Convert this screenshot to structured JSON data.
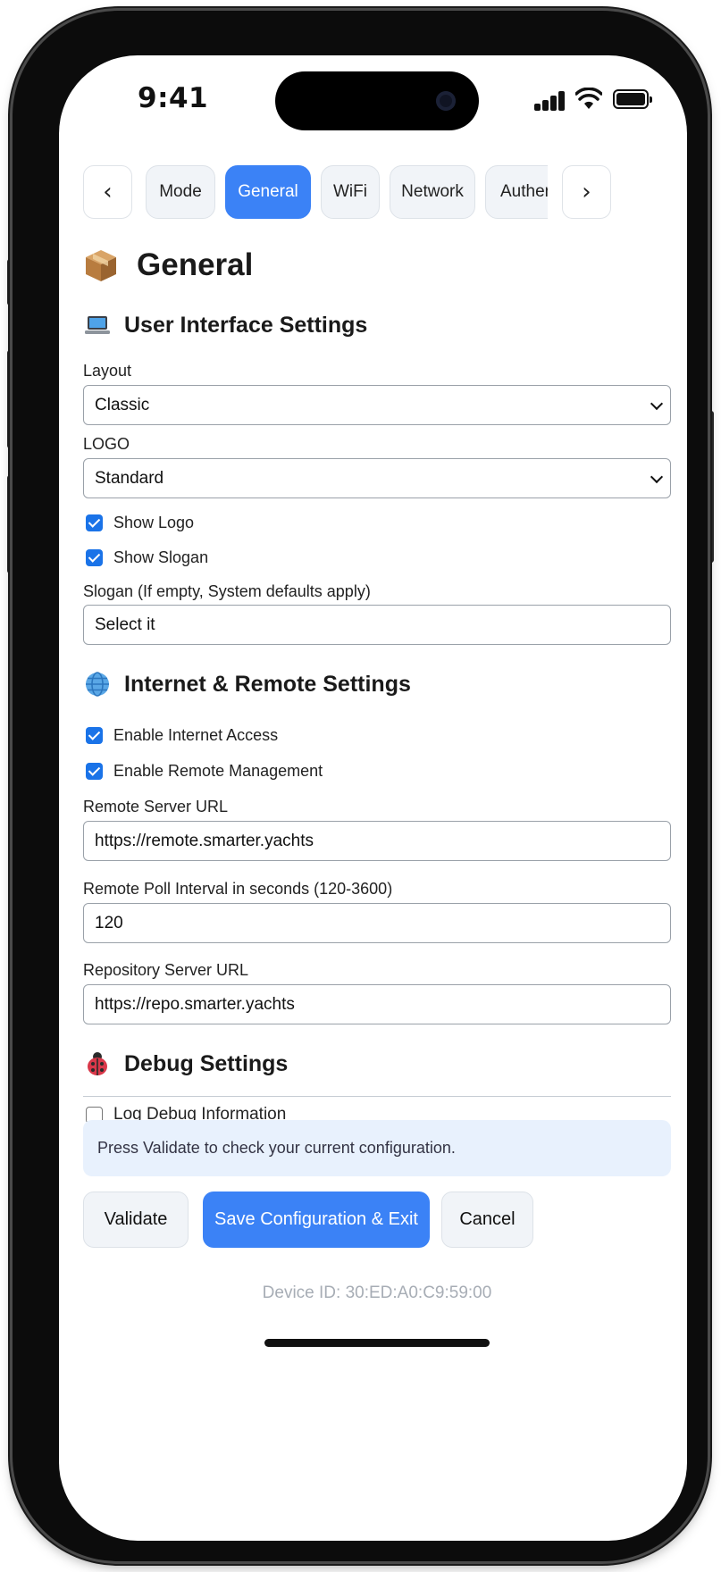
{
  "status": {
    "time": "9:41"
  },
  "tabs": {
    "prev": "‹",
    "next": "›",
    "items": [
      {
        "label": "Mode",
        "active": false
      },
      {
        "label": "General",
        "active": true
      },
      {
        "label": "WiFi",
        "active": false
      },
      {
        "label": "Network",
        "active": false
      },
      {
        "label": "Authentication",
        "active": false
      }
    ]
  },
  "page": {
    "title": "General",
    "icon": "package-icon"
  },
  "ui_settings": {
    "heading": "User Interface Settings",
    "icon": "laptop-icon",
    "layout_label": "Layout",
    "layout_value": "Classic",
    "logo_label": "LOGO",
    "logo_value": "Standard",
    "show_logo": "Show Logo",
    "show_logo_checked": true,
    "show_slogan": "Show Slogan",
    "show_slogan_checked": true,
    "slogan_label": "Slogan (If empty, System defaults apply)",
    "slogan_value": "Select it"
  },
  "internet_settings": {
    "heading": "Internet & Remote Settings",
    "icon": "globe-icon",
    "enable_internet": "Enable Internet Access",
    "enable_internet_checked": true,
    "enable_remote": "Enable Remote Management",
    "enable_remote_checked": true,
    "remote_url_label": "Remote Server URL",
    "remote_url_value": "https://remote.smarter.yachts",
    "poll_label": "Remote Poll Interval in seconds (120-3600)",
    "poll_value": "120",
    "repo_label": "Repository Server URL",
    "repo_value": "https://repo.smarter.yachts"
  },
  "debug_settings": {
    "heading": "Debug Settings",
    "icon": "ladybug-icon",
    "log_debug": "Log Debug Information",
    "log_debug_checked": false
  },
  "info": {
    "message": "Press Validate to check your current configuration."
  },
  "actions": {
    "validate": "Validate",
    "save": "Save Configuration & Exit",
    "cancel": "Cancel"
  },
  "footer": {
    "device_id": "Device ID: 30:ED:A0:C9:59:00"
  },
  "colors": {
    "accent": "#3b82f6",
    "checkbox": "#1a73e8",
    "info_bg": "#e8f1fd"
  }
}
